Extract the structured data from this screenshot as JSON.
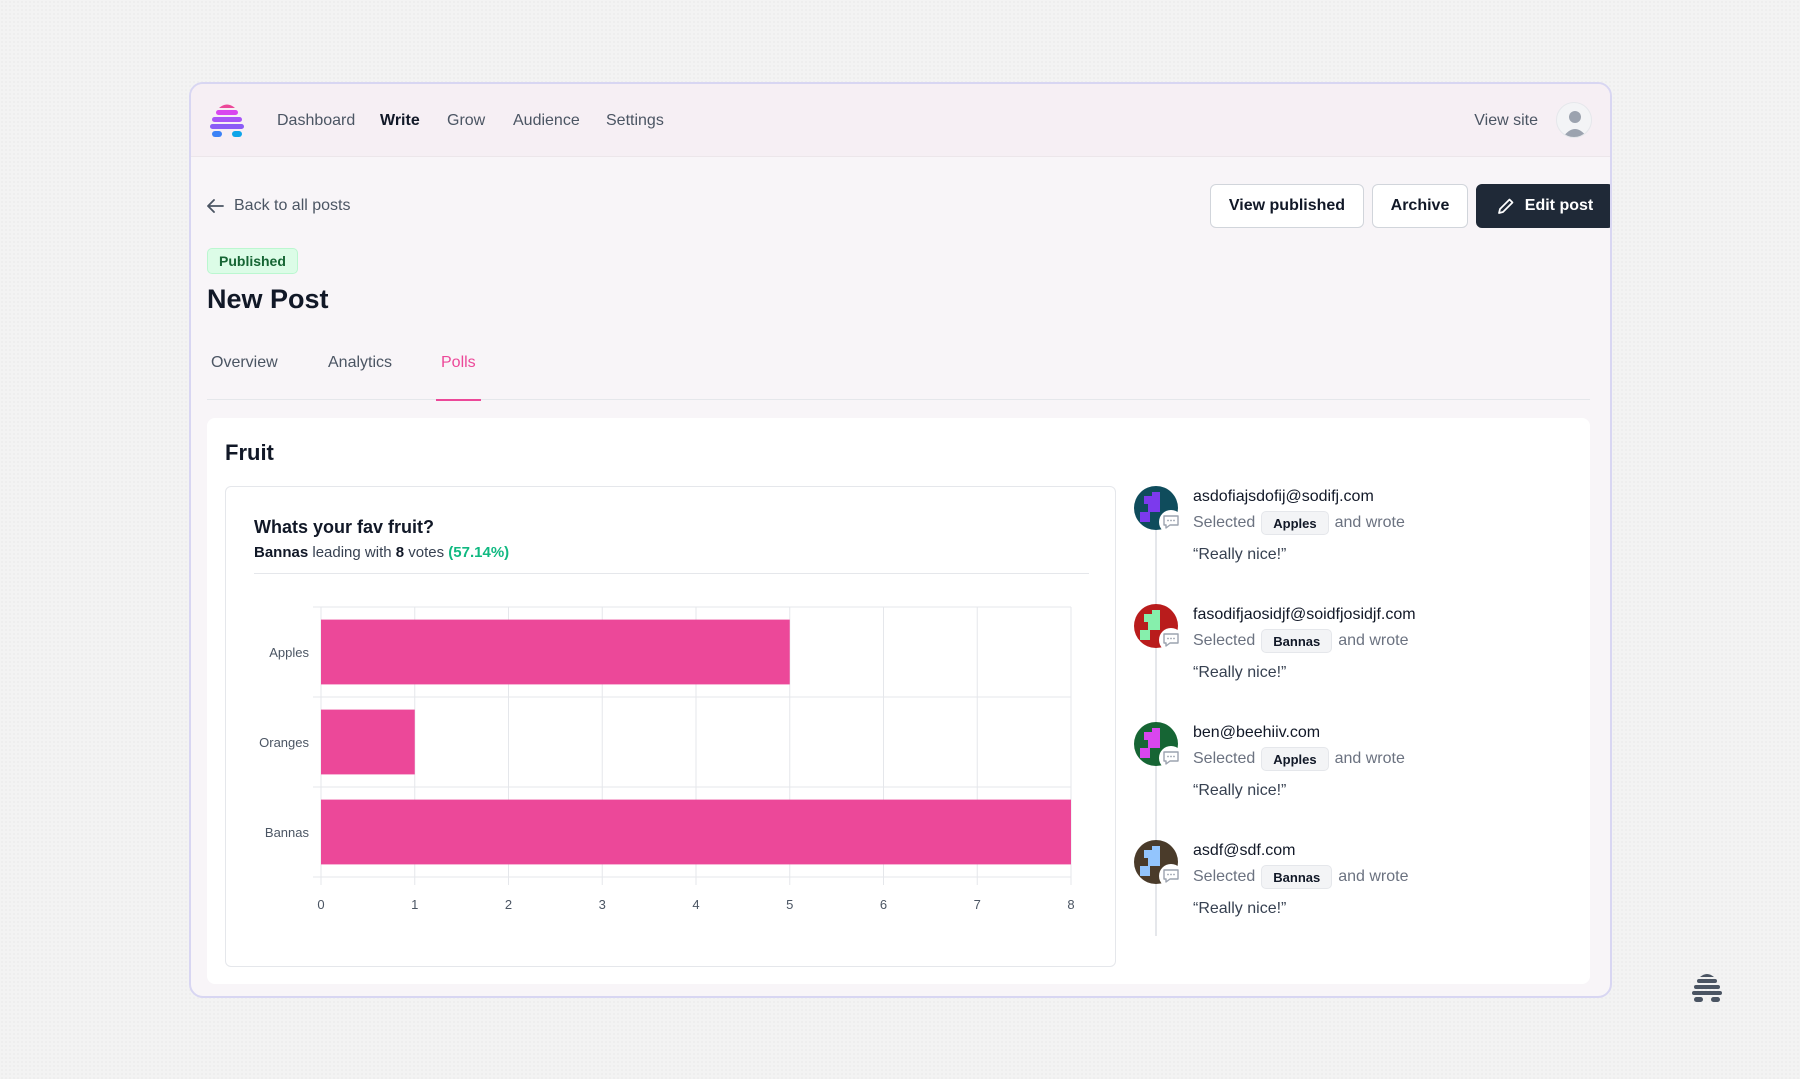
{
  "nav": {
    "links": [
      "Dashboard",
      "Write",
      "Grow",
      "Audience",
      "Settings"
    ],
    "active": "Write",
    "view_site": "View site"
  },
  "header": {
    "back_link": "Back to all posts",
    "buttons": {
      "view_published": "View published",
      "archive": "Archive",
      "edit_post": "Edit post"
    },
    "status_badge": "Published",
    "title": "New Post"
  },
  "tabs": [
    {
      "label": "Overview",
      "active": false
    },
    {
      "label": "Analytics",
      "active": false
    },
    {
      "label": "Polls",
      "active": true
    }
  ],
  "poll": {
    "name": "Fruit",
    "question": "Whats your fav fruit?",
    "leader": "Bannas",
    "leader_text_1": " leading with ",
    "leader_votes": "8",
    "leader_text_2": " votes ",
    "leader_pct": "(57.14%)"
  },
  "chart_data": {
    "type": "bar",
    "orientation": "horizontal",
    "categories": [
      "Apples",
      "Oranges",
      "Bannas"
    ],
    "values": [
      5,
      1,
      8
    ],
    "xlim": [
      0,
      8
    ],
    "xticks": [
      "0",
      "1",
      "2",
      "3",
      "4",
      "5",
      "6",
      "7",
      "8"
    ],
    "grid": true,
    "bar_color": "#ec4899"
  },
  "responses": [
    {
      "email": "asdofiajsdofij@sodifj.com",
      "selected_label": "Selected",
      "choice": "Apples",
      "wrote_label": "and wrote",
      "quote": "“Really nice!”",
      "avatar_colors": [
        "#0f4c5c",
        "#7c3aed"
      ]
    },
    {
      "email": "fasodifjaosidjf@soidfjosidjf.com",
      "selected_label": "Selected",
      "choice": "Bannas",
      "wrote_label": "and wrote",
      "quote": "“Really nice!”",
      "avatar_colors": [
        "#b91c1c",
        "#86efac"
      ]
    },
    {
      "email": "ben@beehiiv.com",
      "selected_label": "Selected",
      "choice": "Apples",
      "wrote_label": "and wrote",
      "quote": "“Really nice!”",
      "avatar_colors": [
        "#166534",
        "#d946ef"
      ]
    },
    {
      "email": "asdf@sdf.com",
      "selected_label": "Selected",
      "choice": "Bannas",
      "wrote_label": "and wrote",
      "quote": "“Really nice!”",
      "avatar_colors": [
        "#4a3b2a",
        "#93c5fd"
      ]
    }
  ],
  "colors": {
    "accent": "#ec4899",
    "success": "#10b981",
    "primary_button": "#1f2937"
  },
  "icons": [
    "beehiiv-logo-icon",
    "arrow-left-icon",
    "pencil-icon",
    "user-avatar-icon",
    "comment-icon"
  ]
}
